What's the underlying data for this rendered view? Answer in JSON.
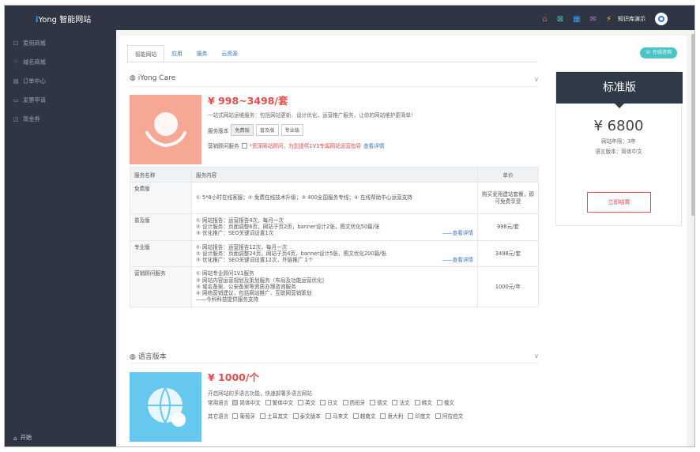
{
  "app": {
    "logo_i": "i",
    "logo_rest": "Yong 智能网站",
    "user": "知识库演示"
  },
  "top_icons": [
    "home-icon",
    "chart-icon",
    "building-icon",
    "mail-icon",
    "lightning-icon"
  ],
  "top_icon_glyphs": [
    "⌂",
    "⊠",
    "▦",
    "✉",
    "⚡"
  ],
  "top_icon_colors": [
    "#e8574a",
    "#4cc3c6",
    "#3a9bf0",
    "#b86bd6",
    "#f5c518"
  ],
  "sidebar": {
    "items": [
      {
        "icon": "☐",
        "label": "爱用商城"
      },
      {
        "icon": "♡",
        "label": "域名商城"
      },
      {
        "icon": "▤",
        "label": "订单中心"
      },
      {
        "icon": "▭",
        "label": "发票申请"
      },
      {
        "icon": "◫",
        "label": "现金券"
      }
    ],
    "start": "开始"
  },
  "tabs": [
    "智能网站",
    "应用",
    "服务",
    "云资源"
  ],
  "online_btn": "在线咨询",
  "care": {
    "title": "iYong Care",
    "price": "¥ 998~3498/套",
    "desc": "一站式网站运维服务：包括网站更新、设计优化、运营推广服务，让你的网站维护更简单！",
    "version_label": "服务版本",
    "versions": [
      "免费版",
      "普及版",
      "专业版"
    ],
    "consult_label": "营销顾问服务",
    "consult_red": "*资深网站顾问，为您提供1V1专属网站运营指导",
    "consult_link": "查看详情"
  },
  "table": {
    "headers": [
      "服务名称",
      "服务内容",
      "单价"
    ],
    "rows": [
      {
        "name": "免费版",
        "content": [
          "① 5*8小时在线客服；② 免费在线技术升级；③ 400全国服务专线；④ 在线帮助中心运营支持"
        ],
        "link": "",
        "price": "购买爱用建站套餐，即可免费享受"
      },
      {
        "name": "普及版",
        "content": [
          "① 网站报告：运营报告4次，每月一次",
          "② 设计服务：页面调整6页，网站子页2页，banner设计2张，图文优化50篇/张",
          "③ 优化推广：SEO关键词设置1次"
        ],
        "link": "——查看详情",
        "price": "998元/套"
      },
      {
        "name": "专业版",
        "content": [
          "① 网站报告：运营报告12次，每月一次",
          "② 设计服务：页面调整24页，网站子页4页，banner设计5张，图文优化200篇/张",
          "③ 优化推广：SEO关键词设置12次，外链推广 1个"
        ],
        "link": "——查看详情",
        "price": "3498元/套"
      },
      {
        "name": "营销顾问服务",
        "content": [
          "① 网站专业顾问1V1服务",
          "② 网站内容运营规划及策划服务（布局及功能运营优化）",
          "③ 域名备案、公安备案等资质办理咨询服务",
          "④ 网络营销建议，包括网站推广、互联网营销策划",
          "——今科科技提供服务支持"
        ],
        "link": "",
        "price": "1000元/年"
      }
    ]
  },
  "lang": {
    "title": "语言版本",
    "price": "¥ 1000/个",
    "desc": "开启网站的多语言功能，快速部署多语言网站",
    "common_label": "常用语言",
    "common": [
      "简体中文",
      "繁体中文",
      "英文",
      "日文",
      "西班牙",
      "德文",
      "法文",
      "韩文",
      "俄文"
    ],
    "other_label": "其它语言",
    "other": [
      "葡萄牙",
      "土耳其文",
      "泰文版本",
      "马来文",
      "越南文",
      "意大利",
      "印度文",
      "阿拉伯文"
    ]
  },
  "card": {
    "title": "标准版",
    "price": "¥ 6800",
    "years": "网站年限：3年",
    "lang": "语言版本：简体中文",
    "button": "立即结算"
  }
}
